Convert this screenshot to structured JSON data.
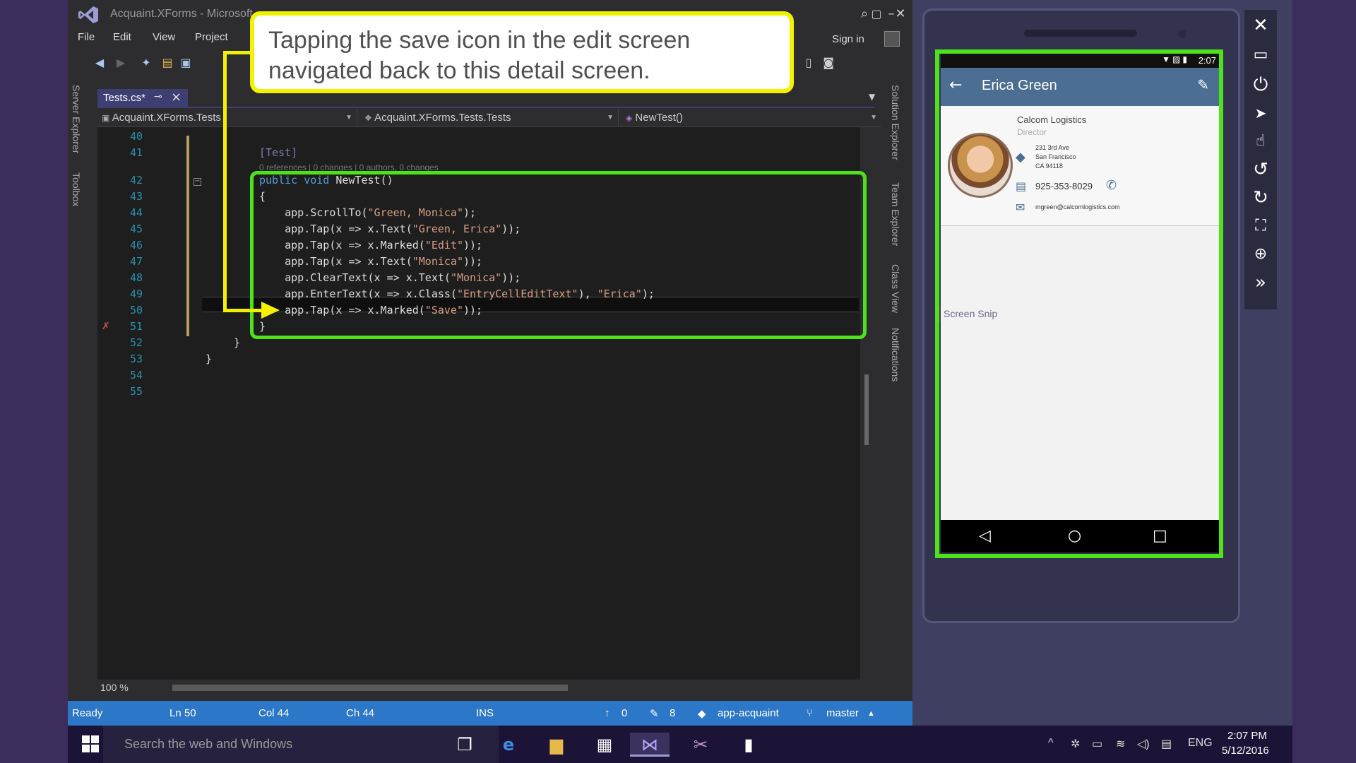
{
  "vs": {
    "title": "Acquaint.XForms - Microsoft",
    "menu": [
      "File",
      "Edit",
      "View",
      "Project"
    ],
    "sign_in": "Sign in",
    "left_tabs": [
      "Server Explorer",
      "Toolbox"
    ],
    "right_tabs": [
      "Solution Explorer",
      "Team Explorer",
      "Class View",
      "Notifications"
    ],
    "doc_tab": "Tests.cs*",
    "nav": {
      "project": "Acquaint.XForms.Tests",
      "type": "Acquaint.XForms.Tests.Tests",
      "member": "NewTest()"
    },
    "zoom": "100 %",
    "status": {
      "ready": "Ready",
      "ln": "Ln 50",
      "col": "Col 44",
      "ch": "Ch 44",
      "ins": "INS",
      "up": "0",
      "pencil": "8",
      "repo": "app-acquaint",
      "branch": "master"
    }
  },
  "code": {
    "line_numbers": [
      "40",
      "41",
      "",
      "42",
      "43",
      "44",
      "45",
      "46",
      "47",
      "48",
      "49",
      "50",
      "51",
      "52",
      "53",
      "54",
      "55"
    ],
    "attribute": "[Test]",
    "codelens": "0 references | 0 changes | 0 authors, 0 changes",
    "lines": [
      {
        "kw": "public void ",
        "text": "NewTest()"
      },
      {
        "text": "{"
      },
      {
        "pre": "    app.ScrollTo(",
        "str": "\"Green, Monica\"",
        "post": ");"
      },
      {
        "pre": "    app.Tap(x => x.Text(",
        "str": "\"Green, Erica\"",
        "post": "));"
      },
      {
        "pre": "    app.Tap(x => x.Marked(",
        "str": "\"Edit\"",
        "post": "));"
      },
      {
        "pre": "    app.Tap(x => x.Text(",
        "str": "\"Monica\"",
        "post": "));"
      },
      {
        "pre": "    app.ClearText(x => x.Text(",
        "str": "\"Monica\"",
        "post": "));"
      },
      {
        "pre": "    app.EnterText(x => x.Class(",
        "str": "\"EntryCellEditText\"",
        "mid": "), ",
        "str2": "\"Erica\"",
        "post": ");"
      },
      {
        "pre": "    app.Tap(x => x.Marked(",
        "str": "\"Save\"",
        "post": "));"
      },
      {
        "text": "}"
      }
    ],
    "close1": "}",
    "close2": "}"
  },
  "callout": {
    "text": "Tapping the save icon in the edit screen navigated back to this detail screen."
  },
  "phone": {
    "time": "2:07",
    "title": "Erica Green",
    "company": "Calcom Logistics",
    "role": "Director",
    "address": [
      "231 3rd Ave",
      "San Francisco",
      "CA 94118"
    ],
    "phone": "925-353-8029",
    "email": "mgreen@calcomlogistics.com"
  },
  "overlay_text": "Screen Snip",
  "taskbar": {
    "search": "Search the web and Windows",
    "lang": "ENG",
    "time": "2:07 PM",
    "date": "5/12/2016"
  },
  "colors": {
    "callout_border": "#f2f200",
    "highlight": "#4ee21a",
    "status_bar": "#2c77c8"
  }
}
